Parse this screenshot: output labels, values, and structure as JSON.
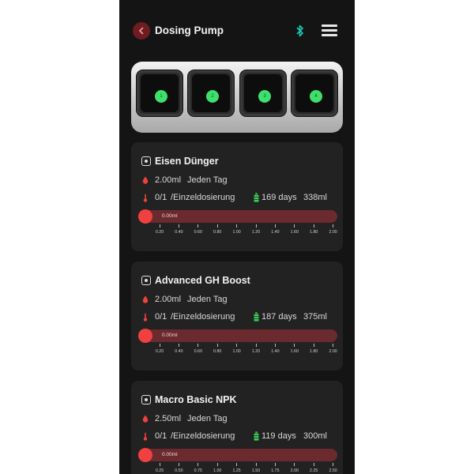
{
  "header": {
    "title": "Dosing Pump"
  },
  "pump_slots": [
    {
      "label": "1"
    },
    {
      "label": "2"
    },
    {
      "label": "3"
    },
    {
      "label": "4"
    }
  ],
  "colors": {
    "accent_red": "#f04040",
    "track_red": "#6a2a2e",
    "led_green": "#3ee06b",
    "bluetooth_teal": "#19c8b8",
    "bottle_green": "#3ec95a",
    "background": "#141414",
    "card": "#222222"
  },
  "icons": {
    "back": "chevron-left-icon",
    "bluetooth": "bluetooth-icon",
    "menu": "hamburger-menu-icon",
    "channel": "channel-icon",
    "drop": "drop-icon",
    "thermometer": "thermometer-icon",
    "bottle": "bottle-icon"
  },
  "cards": [
    {
      "name": "Eisen Dünger",
      "amount": "2.00ml",
      "frequency": "Jeden Tag",
      "count": "0/1",
      "mode": "/Einzeldosierung",
      "days": "169 days",
      "volume": "338ml",
      "slider_value": "0.00ml",
      "scale": [
        "0.20",
        "0.40",
        "0.60",
        "0.80",
        "1.00",
        "1.20",
        "1.40",
        "1.60",
        "1.80",
        "2.00"
      ]
    },
    {
      "name": "Advanced GH Boost",
      "amount": "2.00ml",
      "frequency": "Jeden Tag",
      "count": "0/1",
      "mode": "/Einzeldosierung",
      "days": "187 days",
      "volume": "375ml",
      "slider_value": "0.00ml",
      "scale": [
        "0.20",
        "0.40",
        "0.60",
        "0.80",
        "1.00",
        "1.20",
        "1.40",
        "1.60",
        "1.80",
        "2.00"
      ]
    },
    {
      "name": "Macro Basic NPK",
      "amount": "2.50ml",
      "frequency": "Jeden Tag",
      "count": "0/1",
      "mode": "/Einzeldosierung",
      "days": "119 days",
      "volume": "300ml",
      "slider_value": "0.00ml",
      "scale": [
        "0.25",
        "0.50",
        "0.75",
        "1.00",
        "1.25",
        "1.50",
        "1.75",
        "2.00",
        "2.25",
        "2.50"
      ]
    }
  ]
}
